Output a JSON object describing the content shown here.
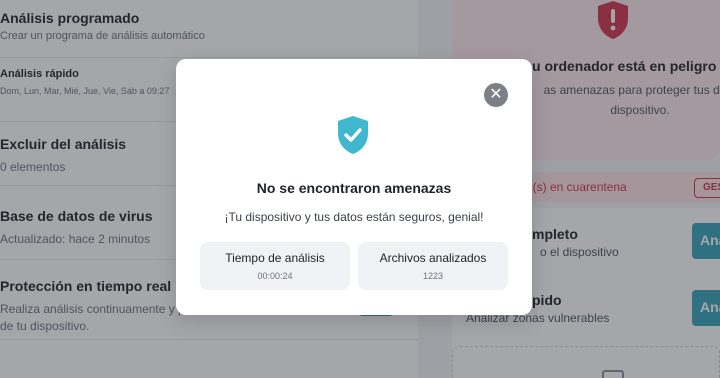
{
  "background": {
    "left_rows": [
      {
        "title": "Análisis programado",
        "sub": "Crear un programa de análisis automático"
      },
      {
        "title": "Análisis rápido",
        "sub": "Dom, Lun, Mar, Mié, Jue, Vie, Sáb a 09:27"
      },
      {
        "title": "Excluir del análisis",
        "sub": "0 elementos"
      },
      {
        "title": "Base de datos de virus",
        "sub": "Actualizado: hace 2 minutos"
      },
      {
        "title": "Protección en tiempo real",
        "sub": "Realiza análisis continuamente y p",
        "sub2": "de tu dispositivo."
      }
    ],
    "right": {
      "danger_title": "u ordenador está en peligro",
      "danger_desc_line1": "as amenazas para proteger tus dato",
      "danger_desc_line2": "dispositivo.",
      "quarantine_text": "a(s) en cuarentena",
      "quarantine_btn": "GES",
      "full_scan_title": "mpleto",
      "full_scan_sub": "o el dispositivo",
      "quick_scan_title": "pido",
      "quick_scan_sub": "Analizar zonas vulnerables",
      "scan_button": "Ana"
    }
  },
  "modal": {
    "title": "No se encontraron amenazas",
    "message": "¡Tu dispositivo y tus datos están seguros, genial!",
    "close_symbol": "✕",
    "stats": [
      {
        "label": "Tiempo de análisis",
        "value": "00:00:24"
      },
      {
        "label": "Archivos analizados",
        "value": "1223"
      }
    ]
  },
  "colors": {
    "accent": "#35a3b8",
    "shield_ok": "#3fb7cf",
    "danger": "#d1354c"
  },
  "icons": {
    "modal_shield": "shield-check-icon",
    "danger_shield": "shield-alert-icon",
    "close": "close-icon",
    "folder": "folder-icon"
  }
}
